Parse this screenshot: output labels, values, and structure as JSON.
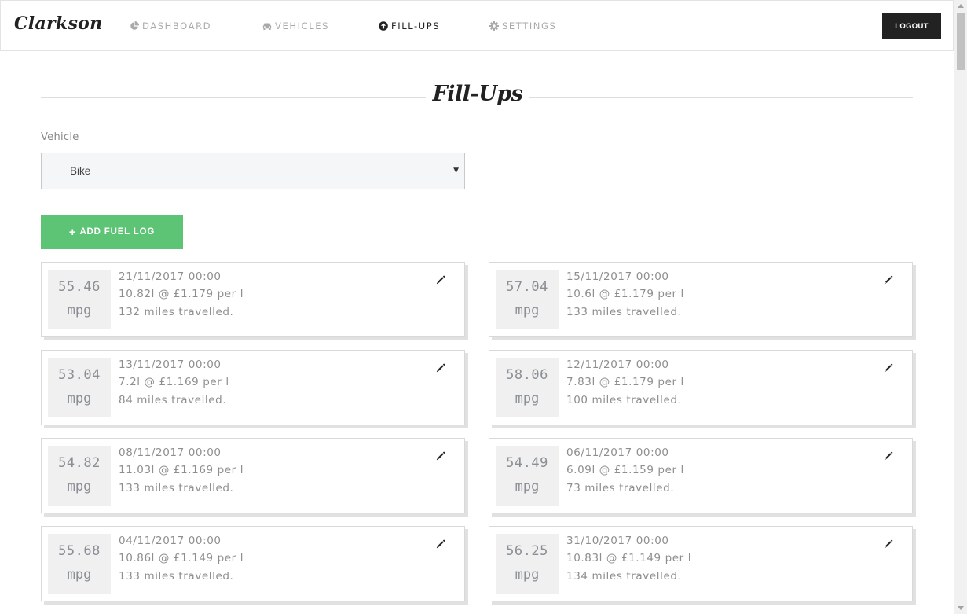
{
  "app": {
    "brand": "Clarkson"
  },
  "nav": {
    "dashboard": "DASHBOARD",
    "vehicles": "VEHICLES",
    "fillups": "FILL-UPS",
    "settings": "SETTINGS",
    "logout": "LOGOUT"
  },
  "page": {
    "title": "Fill-Ups"
  },
  "vehicle": {
    "label": "Vehicle",
    "selected": "Bike"
  },
  "actions": {
    "add_fuel_log": "ADD FUEL LOG"
  },
  "colors": {
    "accent_green": "#5cc474",
    "dark": "#222222",
    "muted": "#8e8e8e"
  },
  "icons": {
    "dashboard": "pie-chart-icon",
    "vehicles": "car-icon",
    "fillups": "arrow-circle-up-icon",
    "settings": "gear-icon",
    "edit": "pencil-icon",
    "add": "plus-icon"
  },
  "fillups": [
    {
      "mpg": "55.46",
      "unit": "mpg",
      "date": "21/11/2017 00:00",
      "fuel": "10.82l @ £1.179 per l",
      "distance": "132 miles travelled."
    },
    {
      "mpg": "57.04",
      "unit": "mpg",
      "date": "15/11/2017 00:00",
      "fuel": "10.6l @ £1.179 per l",
      "distance": "133 miles travelled."
    },
    {
      "mpg": "53.04",
      "unit": "mpg",
      "date": "13/11/2017 00:00",
      "fuel": "7.2l @ £1.169 per l",
      "distance": "84 miles travelled."
    },
    {
      "mpg": "58.06",
      "unit": "mpg",
      "date": "12/11/2017 00:00",
      "fuel": "7.83l @ £1.179 per l",
      "distance": "100 miles travelled."
    },
    {
      "mpg": "54.82",
      "unit": "mpg",
      "date": "08/11/2017 00:00",
      "fuel": "11.03l @ £1.169 per l",
      "distance": "133 miles travelled."
    },
    {
      "mpg": "54.49",
      "unit": "mpg",
      "date": "06/11/2017 00:00",
      "fuel": "6.09l @ £1.159 per l",
      "distance": "73 miles travelled."
    },
    {
      "mpg": "55.68",
      "unit": "mpg",
      "date": "04/11/2017 00:00",
      "fuel": "10.86l @ £1.149 per l",
      "distance": "133 miles travelled."
    },
    {
      "mpg": "56.25",
      "unit": "mpg",
      "date": "31/10/2017 00:00",
      "fuel": "10.83l @ £1.149 per l",
      "distance": "134 miles travelled."
    }
  ]
}
